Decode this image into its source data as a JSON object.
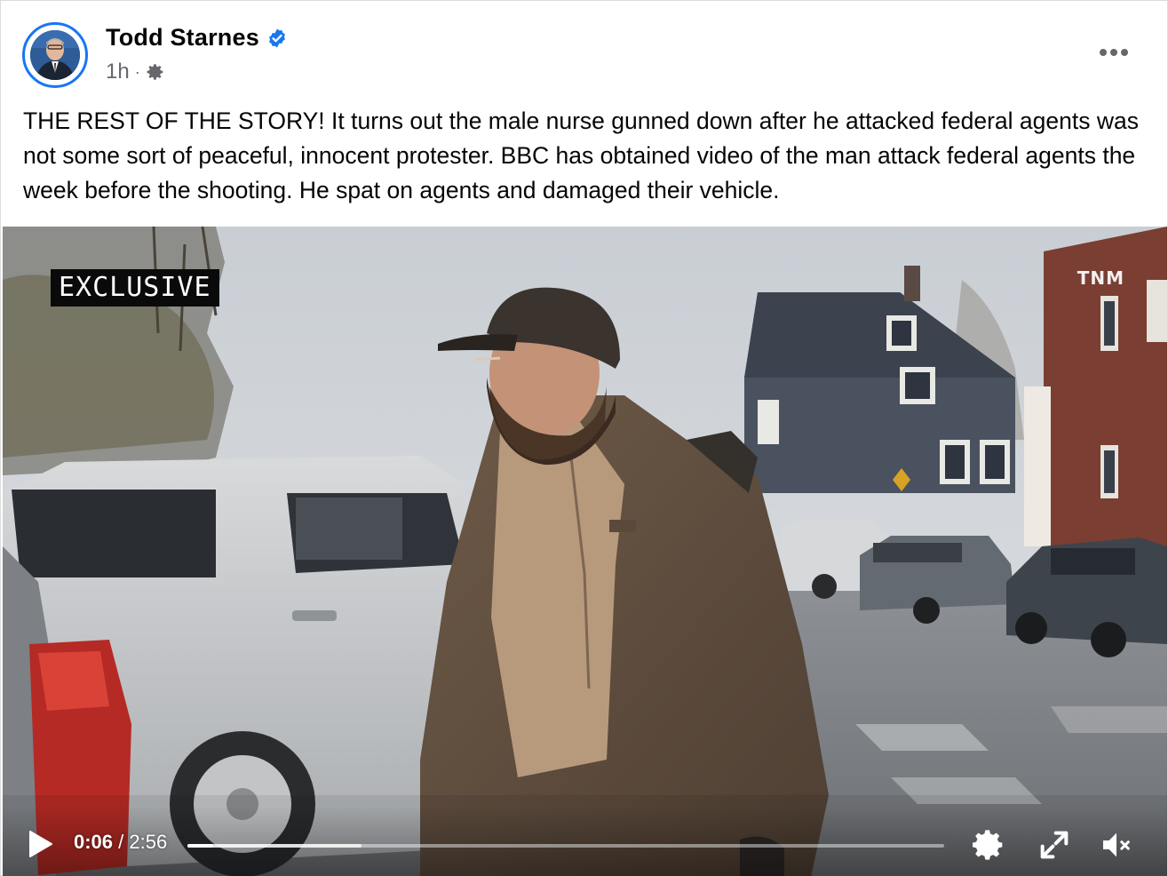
{
  "post": {
    "author_name": "Todd Starnes",
    "timestamp": "1h",
    "separator": "·",
    "privacy_icon": "gear-icon",
    "verified_icon": "verified-badge-icon",
    "more_icon": "more-horizontal-icon",
    "body_text": "THE REST OF THE STORY! It turns out the male nurse gunned down after he attacked federal agents was not some sort of peaceful, innocent protester. BBC has obtained video of the man attack federal agents the week before the shooting. He spat on agents and damaged their vehicle."
  },
  "video": {
    "badge_text": "EXCLUSIVE",
    "watermark": "TNM",
    "current_time": "0:06",
    "time_separator": " / ",
    "duration": "2:56",
    "progress_fraction": 0.034,
    "buffered_fraction": 0.23,
    "icons": {
      "play": "play-icon",
      "settings": "settings-gear-icon",
      "fullscreen": "fullscreen-icon",
      "mute": "volume-muted-icon"
    }
  },
  "colors": {
    "accent": "#1877f2",
    "text": "#050505",
    "secondary_text": "#65676b"
  }
}
